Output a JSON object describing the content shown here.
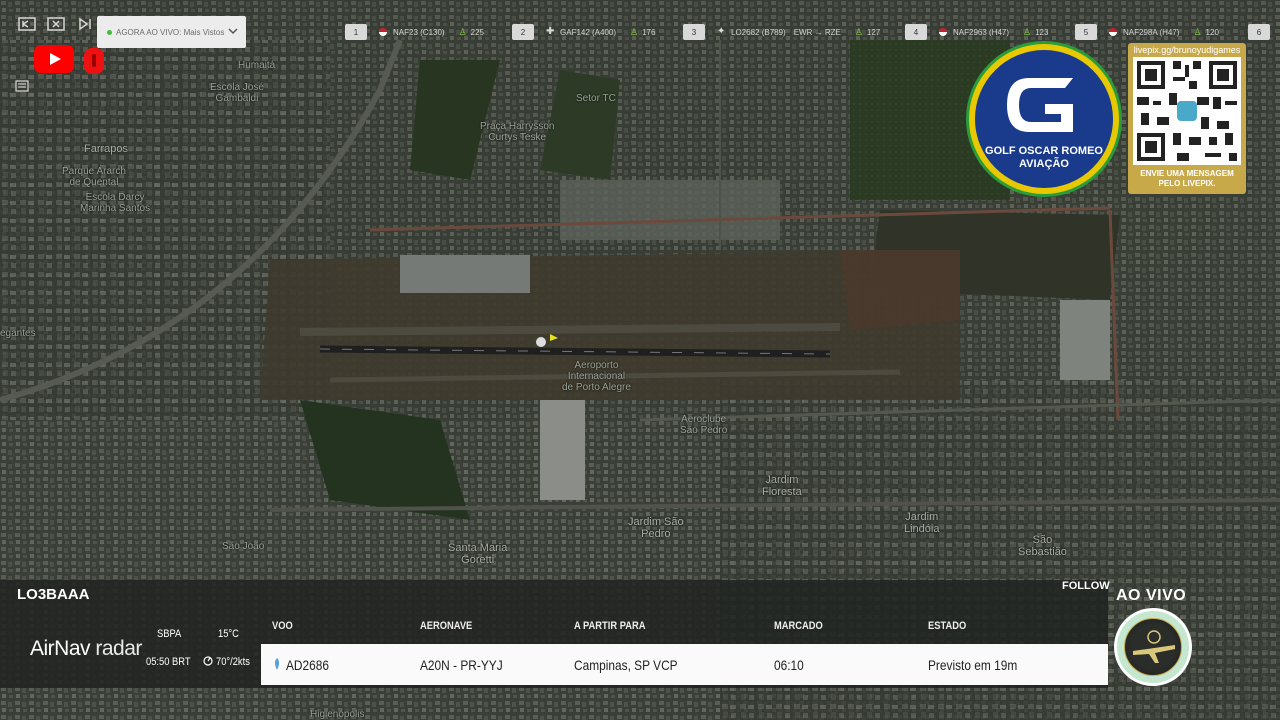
{
  "topbar": {
    "live_select": "AGORA AO VIVO: Mais Vistos",
    "flights": [
      {
        "rank": "1",
        "code": "NAF23 (C130)",
        "viewers": "225"
      },
      {
        "rank": "2",
        "code": "GAF142 (A400)",
        "viewers": "176"
      },
      {
        "rank": "3",
        "code": "LO2682 (B789)",
        "route": "EWR → RZE",
        "viewers": "127"
      },
      {
        "rank": "4",
        "code": "NAF2963 (H47)",
        "viewers": "123"
      },
      {
        "rank": "5",
        "code": "NAF298A (H47)",
        "viewers": "120"
      },
      {
        "rank": "6"
      }
    ]
  },
  "map": {
    "labels": {
      "humaita": "Humaitá",
      "escola": "Escola José\nGambaldi",
      "farrapos": "Farrapos",
      "parque": "Parque Ararch\nde Quental",
      "escola2": "Escola Darcy\nMarinha Santos",
      "setor": "Setor TC",
      "praca": "Praça Harrysson\nCurtys Teske",
      "aeroporto": "Aeroporto\nInternacional\nde Porto Alegre",
      "jardim_floresta": "Jardim\nFloresta",
      "jardim_sao_pedro": "Jardim São\nPedro",
      "santa_maria": "Santa Maria\nGoretti",
      "sao_joao": "São João",
      "jardim_lindoia": "Jardim\nLindóia",
      "sao_sebastiao": "São\nSebastião",
      "navegantes": "egantes",
      "aeroclube": "Aeroclube\nSão Pedro",
      "higienopolis": "Higienópolis"
    }
  },
  "badges": {
    "gor_line1": "GOLF OSCAR ROMEO",
    "gor_line2": "AVIAÇÃO",
    "livepix_url": "livepix.gg/brunoyudigames",
    "livepix_msg_1": "ENVIE UMA MENSAGEM",
    "livepix_msg_2": "PELO LIVEPIX.",
    "aovivo": "AO VIVO"
  },
  "panel": {
    "registration": "LO3BAAA",
    "follow": "FOLLOW",
    "airnav": "AirNav",
    "radar": "radar",
    "airport": "SBPA",
    "time": "05:50 BRT",
    "temp": "15°C",
    "wind": "70°/2kts",
    "headers": {
      "voo": "VOO",
      "aeronave": "AERONAVE",
      "rota": "A PARTIR PARA",
      "marcado": "MARCADO",
      "estado": "ESTADO"
    },
    "row": {
      "voo": "AD2686",
      "aeronave": "A20N - PR-YYJ",
      "rota": "Campinas, SP VCP",
      "marcado": "06:10",
      "estado": "Previsto em 19m"
    }
  },
  "colors": {
    "accent_green": "#8fd14f",
    "gor_blue": "#1a3a8c",
    "gor_yellow": "#e8c800",
    "livepix_gold": "#c8a94a"
  }
}
